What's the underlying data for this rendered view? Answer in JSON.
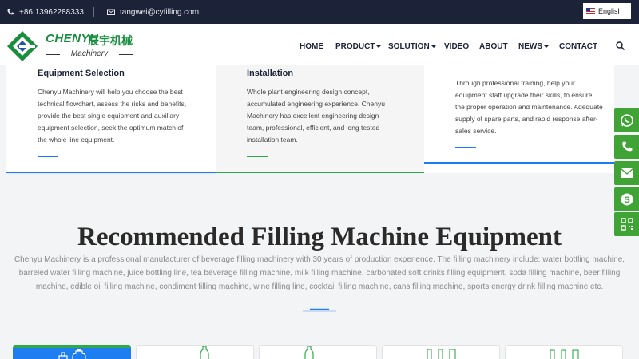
{
  "topbar": {
    "phone": "+86 13962288333",
    "email": "tangwei@cyfilling.com",
    "language": "English"
  },
  "logo": {
    "brand": "CHENYU",
    "brand_cn": "辰宇机械",
    "sub": "Machinery"
  },
  "nav": {
    "items": [
      {
        "label": "HOME"
      },
      {
        "label": "PRODUCT"
      },
      {
        "label": "SOLUTION"
      },
      {
        "label": "VIDEO"
      },
      {
        "label": "ABOUT"
      },
      {
        "label": "NEWS"
      },
      {
        "label": "CONTACT"
      }
    ]
  },
  "cards": [
    {
      "title": "Equipment Selection",
      "text": "Chenyu Machinery will help you choose the best technical flowchart, assess the risks and benefits, provide the best single equipment and auxiliary equipment selection, seek the optimum match of the whole line equipment.",
      "accent": "#1e7df0"
    },
    {
      "title": "Installation",
      "text": "Whole plant engineering design concept, accumulated engineering experience. Chenyu Machinery has excellent engineering design team, professional, efficient, and long tested installation team.",
      "accent": "#2ea84a"
    },
    {
      "title": "",
      "text": "Through professional training, help your equipment staff upgrade their skills, to ensure the proper operation and maintenance. Adequate supply of spare parts, and rapid response after-sales service.",
      "accent": "#1e7df0"
    }
  ],
  "section": {
    "title": "Recommended Filling Machine Equipment",
    "description": "Chenyu Machinery is a professional manufacturer of beverage filling machinery with 30 years of production experience. The filling machinery include: water bottling machine, barreled water filling machine, juice bottling line, tea beverage filling machine, milk filling machine, carbonated soft drinks filling equipment, soda filling machine, beer filling machine, edible oil filling machine, condiment filling machine, wine filling line, cocktail filling machine, cans filling machine, sports energy drink filling machine etc."
  },
  "social": [
    "whatsapp-icon",
    "phone-icon",
    "mail-icon",
    "skype-icon",
    "qrcode-icon"
  ],
  "colors": {
    "topbar": "#1c2237",
    "brand_green": "#1a8e3f",
    "accent_blue": "#1e7df0",
    "accent_green": "#2ea84a",
    "social_green": "#3fa435"
  }
}
